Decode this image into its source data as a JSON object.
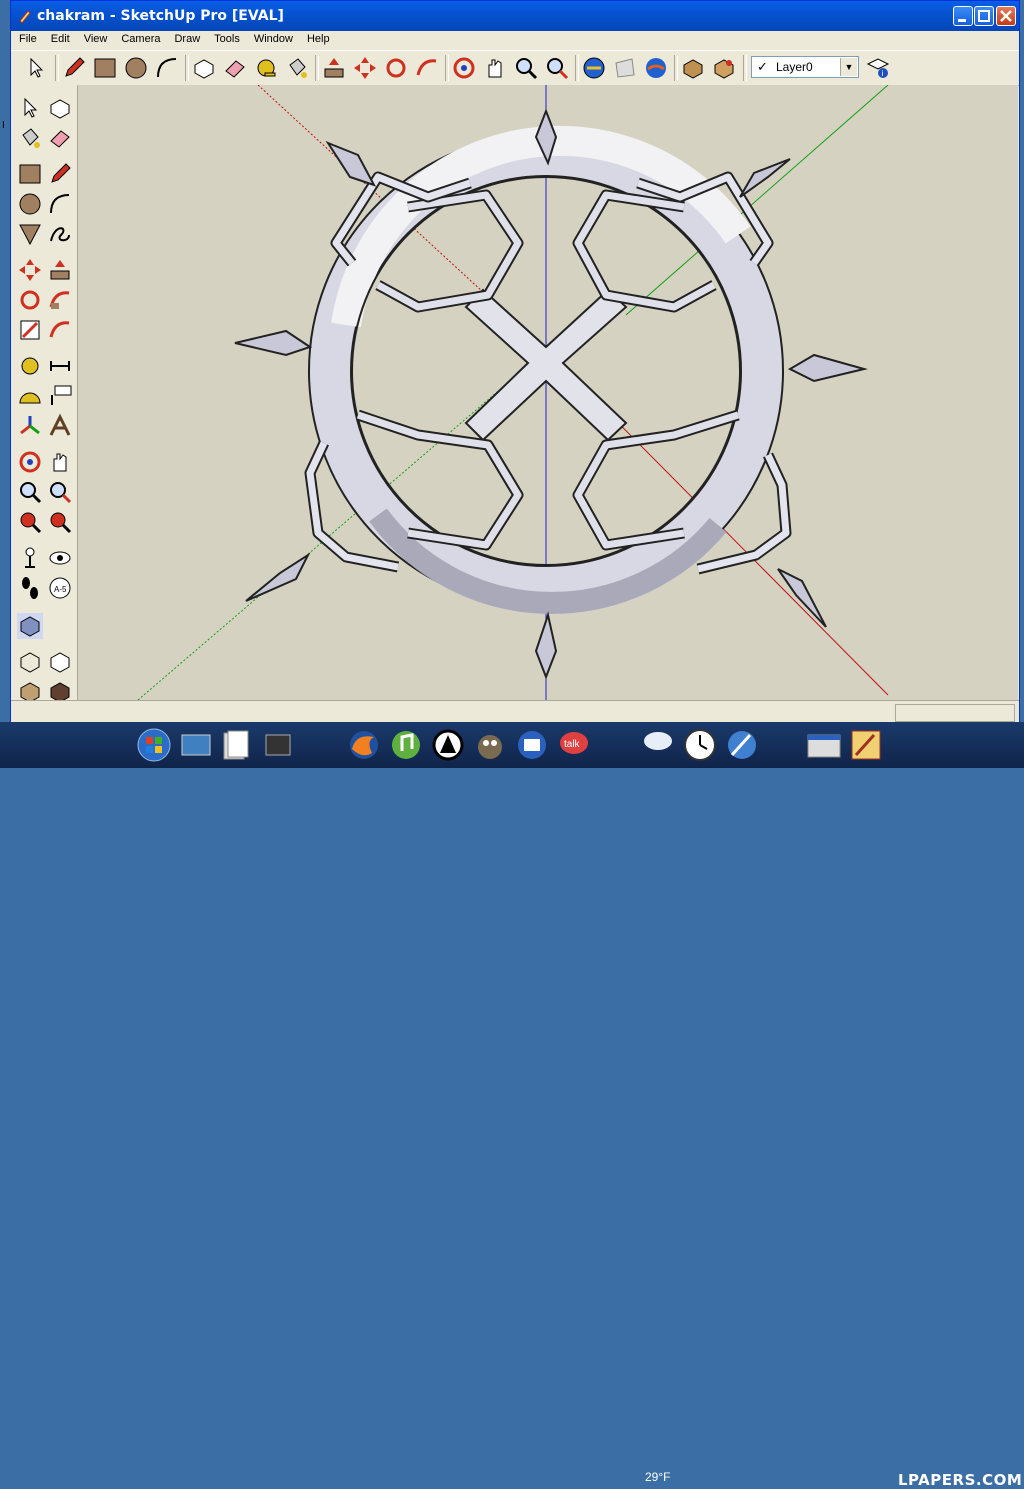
{
  "window": {
    "title": "chakram - SketchUp Pro [EVAL]",
    "buttons": [
      "minimize",
      "maximize",
      "close"
    ]
  },
  "menu": [
    "File",
    "Edit",
    "View",
    "Camera",
    "Draw",
    "Tools",
    "Window",
    "Help"
  ],
  "toolbar": {
    "icons": [
      "select-icon",
      "pencil-icon",
      "rectangle-icon",
      "circle-icon",
      "arc-icon",
      "make-component-icon",
      "eraser-icon",
      "tape-measure-icon",
      "paint-bucket-icon",
      "push-pull-icon",
      "move-icon",
      "rotate-icon",
      "follow-me-icon",
      "orbit-icon",
      "pan-icon",
      "zoom-icon",
      "zoom-extents-icon",
      "get-models-icon",
      "share-model-icon",
      "google-earth-icon",
      "components-icon",
      "materials-icon",
      "layer-manager-icon"
    ],
    "layer": {
      "checked": "✓",
      "name": "Layer0"
    }
  },
  "left_toolbar": {
    "icons": [
      "select-icon",
      "make-component-icon",
      "paint-bucket-icon",
      "eraser-icon",
      "rectangle-icon",
      "line-icon",
      "circle-icon",
      "arc-icon",
      "polygon-icon",
      "freehand-icon",
      "move-icon",
      "push-pull-icon",
      "rotate-icon",
      "follow-me-icon",
      "scale-icon",
      "offset-icon",
      "tape-measure-icon",
      "dimension-icon",
      "protractor-icon",
      "text-icon",
      "axes-icon",
      "3d-text-icon",
      "orbit-icon",
      "pan-icon",
      "zoom-icon",
      "zoom-window-icon",
      "previous-view-icon",
      "zoom-extents-icon",
      "position-camera-icon",
      "look-around-icon",
      "walk-icon",
      "section-plane-icon",
      "iso-view-icon",
      "xray-icon",
      "wireframe-icon",
      "hidden-line-icon",
      "shaded-icon",
      "shaded-texture-icon"
    ]
  },
  "margin_label": "I",
  "taskbar": {
    "icons": [
      "start-orb-icon",
      "desktop-icon",
      "files-icon",
      "explorer-icon",
      "firefox-icon",
      "itunes-icon",
      "app-icon",
      "gimp-icon",
      "thunderbird-icon",
      "talk-icon",
      "weather-icon",
      "clock-icon",
      "tool-icon",
      "window-thumb-icon",
      "sketchup-icon"
    ],
    "temperature": "29°F",
    "watermark": "LPAPERS.COM"
  },
  "colors": {
    "titlebar": "#0553d1",
    "viewport": "#d5d2c2",
    "axis_blue": "#2020d0",
    "axis_green": "#10a010",
    "axis_red": "#c01010"
  }
}
